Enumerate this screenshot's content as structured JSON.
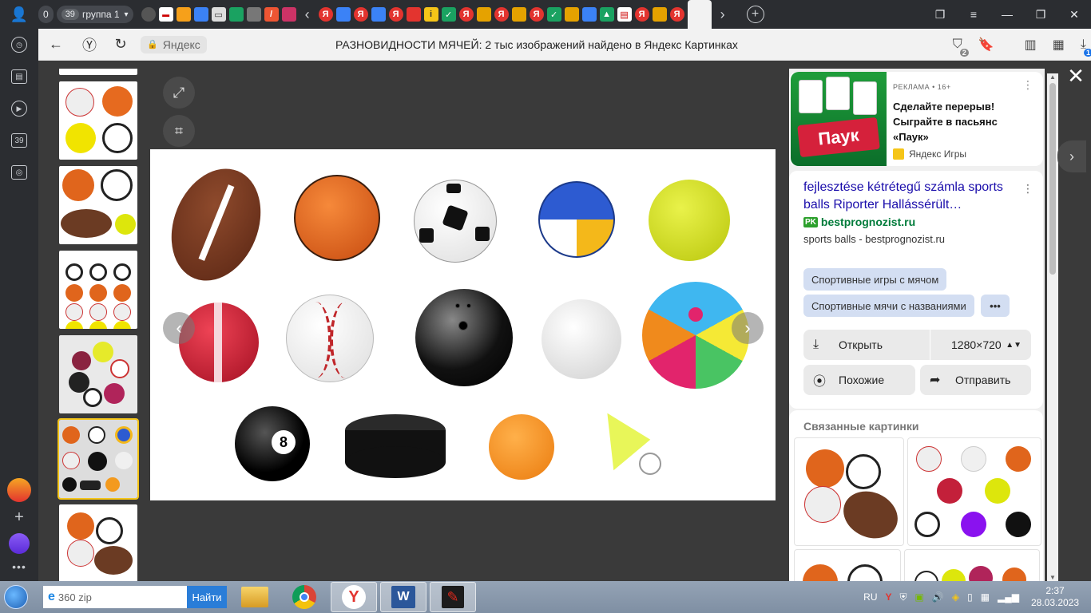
{
  "tabstrip": {
    "counter": "0",
    "group_count": "39",
    "group_label": "группа 1"
  },
  "sidebar": {
    "tabs_count": "39"
  },
  "address_bar": {
    "site": "Яндекс",
    "page_title": "РАЗНОВИДНОСТИ МЯЧЕЙ: 2 тыс изображений найдено в Яндекс Картинках",
    "protect_badge": "2",
    "downloads_badge": "1"
  },
  "ad": {
    "label": "РЕКЛАМА • 16+",
    "image_text": "Паук",
    "title": "Сделайте перерыв! Сыграйте в пасьянс «Паук»",
    "source": "Яндекс Игры"
  },
  "result": {
    "title": "fejlesztése kétrétegű számla sports balls Riporter Hallássérült…",
    "domain_icon": "PK",
    "domain": "bestprognozist.ru",
    "snippet": "sports balls - bestprognozist.ru"
  },
  "chips": [
    "Спортивные игры с мячом",
    "Спортивные мячи с названиями",
    "•••"
  ],
  "actions": {
    "open": "Открыть",
    "size": "1280×720",
    "similar": "Похожие",
    "share": "Отправить"
  },
  "related": {
    "title": "Связанные картинки"
  },
  "main_image": {
    "eight_ball_number": "8"
  },
  "taskbar": {
    "search_value": "360 zip",
    "search_button": "Найти",
    "lang": "RU",
    "time": "2:37",
    "date": "28.03.2023"
  },
  "colors": {
    "accent": "#1a0dab",
    "chip": "#d3def2",
    "thumb_active": "#f5c518"
  }
}
